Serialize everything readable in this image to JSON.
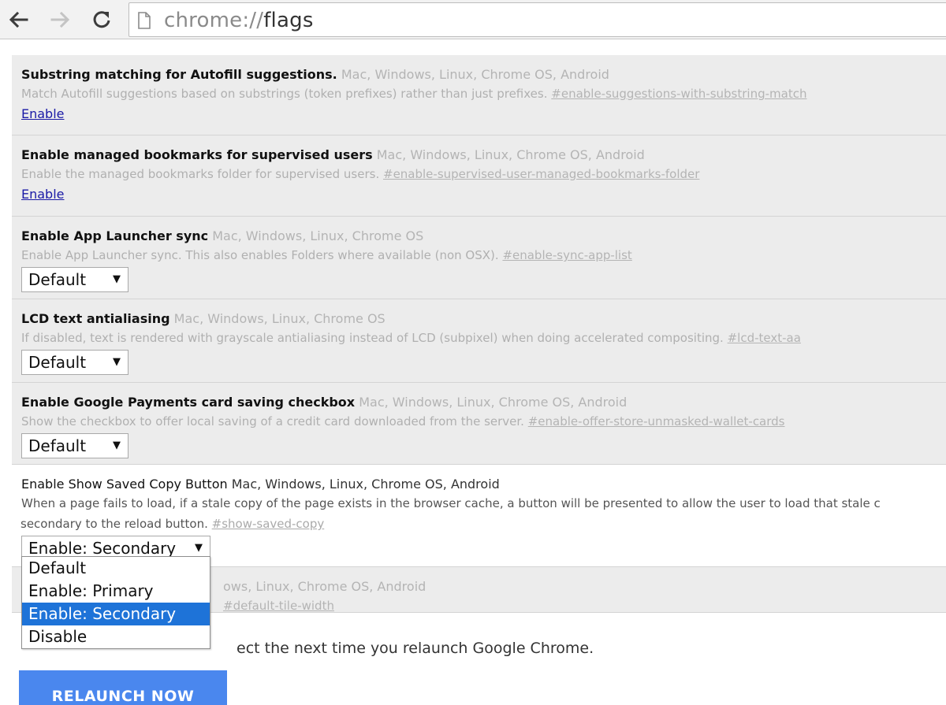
{
  "browser": {
    "url_scheme": "chrome://",
    "url_path": "flags"
  },
  "flags": [
    {
      "title": "Substring matching for Autofill suggestions.",
      "platforms": "Mac, Windows, Linux, Chrome OS, Android",
      "desc1": "Match Autofill suggestions based on substrings (token prefixes) rather than just prefixes.",
      "anchor": "#enable-suggestions-with-substring-match",
      "control_label": "Enable"
    },
    {
      "title": "Enable managed bookmarks for supervised users",
      "platforms": "Mac, Windows, Linux, Chrome OS, Android",
      "desc1": "Enable the managed bookmarks folder for supervised users.",
      "anchor": "#enable-supervised-user-managed-bookmarks-folder",
      "control_label": "Enable"
    },
    {
      "title": "Enable App Launcher sync",
      "platforms": "Mac, Windows, Linux, Chrome OS",
      "desc1": "Enable App Launcher sync. This also enables Folders where available (non OSX).",
      "anchor": "#enable-sync-app-list",
      "select_value": "Default"
    },
    {
      "title": "LCD text antialiasing",
      "platforms": "Mac, Windows, Linux, Chrome OS",
      "desc1": "If disabled, text is rendered with grayscale antialiasing instead of LCD (subpixel) when doing accelerated compositing.",
      "anchor": "#lcd-text-aa",
      "select_value": "Default"
    },
    {
      "title": "Enable Google Payments card saving checkbox",
      "platforms": "Mac, Windows, Linux, Chrome OS, Android",
      "desc1": "Show the checkbox to offer local saving of a credit card downloaded from the server.",
      "anchor": "#enable-offer-store-unmasked-wallet-cards",
      "select_value": "Default"
    },
    {
      "title": "Enable Show Saved Copy Button",
      "platforms": "Mac, Windows, Linux, Chrome OS, Android",
      "desc1": "When a page fails to load, if a stale copy of the page exists in the browser cache, a button will be presented to allow the user to load that stale c",
      "desc2": "secondary to the reload button.",
      "anchor": "#show-saved-copy",
      "select_value": "Enable: Secondary"
    },
    {
      "platforms_partial": "ows, Linux, Chrome OS, Android",
      "anchor_partial": "#default-tile-width"
    }
  ],
  "dropdown": {
    "options": [
      "Default",
      "Enable: Primary",
      "Enable: Secondary",
      "Disable"
    ],
    "selected": "Enable: Secondary"
  },
  "footer": {
    "note": "ect the next time you relaunch Google Chrome.",
    "relaunch_label": "RELAUNCH NOW"
  },
  "colors": {
    "row_background": "#ececec",
    "active_row_background": "#ffffff",
    "link": "#1a1aa6",
    "selected_option": "#1e73d8",
    "relaunch_button": "#4a87ee"
  },
  "icons": [
    "back-arrow-icon",
    "forward-arrow-icon",
    "reload-icon",
    "page-icon",
    "dropdown-caret-icon"
  ]
}
